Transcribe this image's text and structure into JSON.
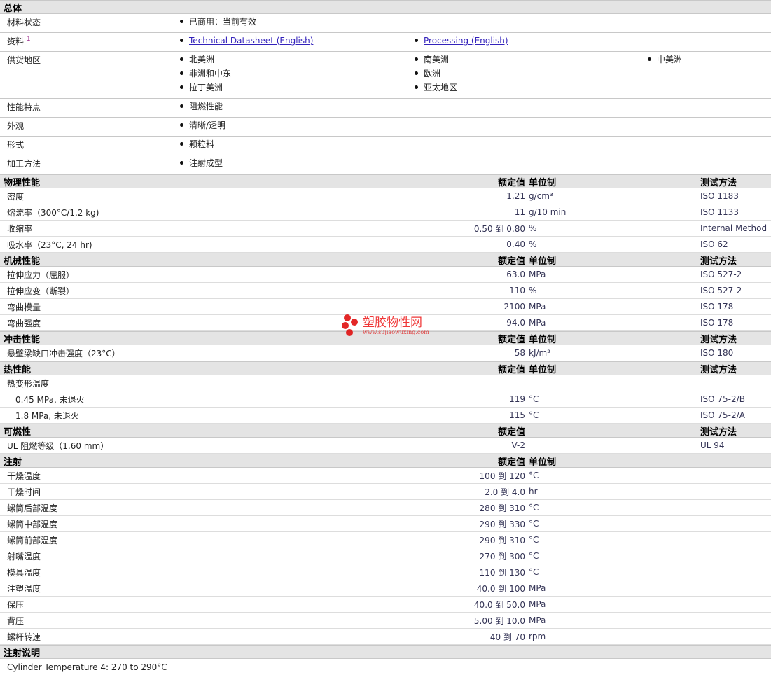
{
  "general": {
    "title": "总体",
    "rows": [
      {
        "label": "材料状态",
        "items": [
          [
            "已商用：当前有效"
          ]
        ]
      },
      {
        "label": "资料",
        "note": "1",
        "links": [
          "Technical Datasheet (English)",
          "Processing (English)"
        ]
      },
      {
        "label": "供货地区",
        "items": [
          [
            "北美洲",
            "非洲和中东",
            "拉丁美洲"
          ],
          [
            "南美洲",
            "欧洲",
            "亚太地区"
          ],
          [
            "中美洲"
          ]
        ]
      },
      {
        "label": "性能特点",
        "items": [
          [
            "阻燃性能"
          ]
        ]
      },
      {
        "label": "外观",
        "items": [
          [
            "清晰/透明"
          ]
        ]
      },
      {
        "label": "形式",
        "items": [
          [
            "颗粒料"
          ]
        ]
      },
      {
        "label": "加工方法",
        "items": [
          [
            "注射成型"
          ]
        ]
      }
    ]
  },
  "headers": {
    "value": "额定值",
    "unit": "单位制",
    "method": "测试方法"
  },
  "sections": [
    {
      "title": "物理性能",
      "unit": true,
      "method": true,
      "rows": [
        {
          "label": "密度",
          "value": "1.21",
          "unit": "g/cm³",
          "method": "ISO 1183"
        },
        {
          "label": "熔流率（300°C/1.2 kg)",
          "value": "11",
          "unit": "g/10 min",
          "method": "ISO 1133"
        },
        {
          "label": "收缩率",
          "value": "0.50 到  0.80",
          "unit": "%",
          "method": "Internal Method"
        },
        {
          "label": "吸水率（23°C, 24 hr)",
          "value": "0.40",
          "unit": "%",
          "method": "ISO 62"
        }
      ]
    },
    {
      "title": "机械性能",
      "unit": true,
      "method": true,
      "rows": [
        {
          "label": "拉伸应力（屈服）",
          "value": "63.0",
          "unit": "MPa",
          "method": "ISO 527-2"
        },
        {
          "label": "拉伸应变（断裂）",
          "value": "110",
          "unit": "%",
          "method": "ISO 527-2"
        },
        {
          "label": "弯曲模量",
          "value": "2100",
          "unit": "MPa",
          "method": "ISO 178"
        },
        {
          "label": "弯曲强度",
          "value": "94.0",
          "unit": "MPa",
          "method": "ISO 178"
        }
      ]
    },
    {
      "title": "冲击性能",
      "unit": true,
      "method": true,
      "rows": [
        {
          "label": "悬壁梁缺口冲击强度（23°C）",
          "value": "58",
          "unit": "kJ/m²",
          "method": "ISO 180"
        }
      ]
    },
    {
      "title": "热性能",
      "unit": true,
      "method": true,
      "rows": [
        {
          "label": "热变形温度",
          "value": "",
          "unit": "",
          "method": ""
        },
        {
          "label": "0.45 MPa, 未退火",
          "indent": true,
          "value": "119",
          "unit": "°C",
          "method": "ISO 75-2/B"
        },
        {
          "label": "1.8 MPa, 未退火",
          "indent": true,
          "value": "115",
          "unit": "°C",
          "method": "ISO 75-2/A"
        }
      ]
    },
    {
      "title": "可燃性",
      "unit": false,
      "method": true,
      "rows": [
        {
          "label": "UL 阻燃等级（1.60 mm）",
          "value": "V-2",
          "unit": "",
          "method": "UL 94"
        }
      ]
    },
    {
      "title": "注射",
      "unit": true,
      "method": false,
      "rows": [
        {
          "label": "干燥温度",
          "value": "100 到  120",
          "unit": "°C",
          "method": ""
        },
        {
          "label": "干燥时间",
          "value": "2.0 到  4.0",
          "unit": "hr",
          "method": ""
        },
        {
          "label": "螺筒后部温度",
          "value": "280 到  310",
          "unit": "°C",
          "method": ""
        },
        {
          "label": "螺筒中部温度",
          "value": "290 到  330",
          "unit": "°C",
          "method": ""
        },
        {
          "label": "螺筒前部温度",
          "value": "290 到  310",
          "unit": "°C",
          "method": ""
        },
        {
          "label": "射嘴温度",
          "value": "270 到  300",
          "unit": "°C",
          "method": ""
        },
        {
          "label": "模具温度",
          "value": "110 到  130",
          "unit": "°C",
          "method": ""
        },
        {
          "label": "注塑温度",
          "value": "40.0 到  100",
          "unit": "MPa",
          "method": ""
        },
        {
          "label": "保压",
          "value": "40.0 到  50.0",
          "unit": "MPa",
          "method": ""
        },
        {
          "label": "背压",
          "value": "5.00 到  10.0",
          "unit": "MPa",
          "method": ""
        },
        {
          "label": "螺杆转速",
          "value": "40 到  70",
          "unit": "rpm",
          "method": ""
        }
      ]
    }
  ],
  "notes": {
    "title": "注射说明",
    "text": "Cylinder Temperature 4: 270 to 290°C"
  },
  "watermark": {
    "name": "塑胶物性网",
    "url": "www.sujiaowuxing.com"
  }
}
